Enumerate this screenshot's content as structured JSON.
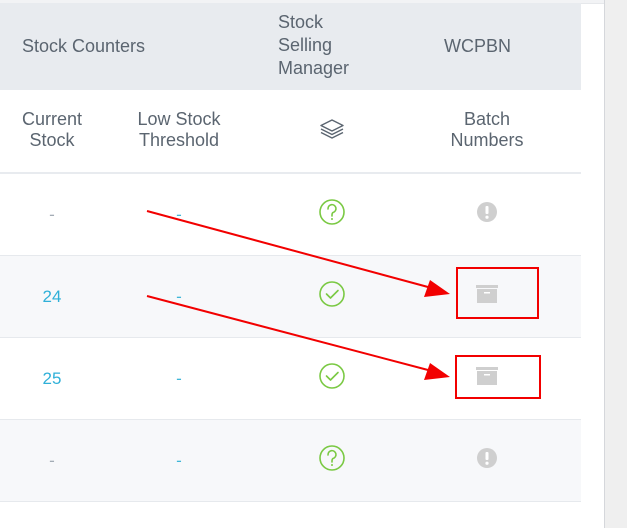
{
  "header": {
    "groups": {
      "stock_counters": "Stock Counters",
      "stock_selling_manager_line1": "Stock",
      "stock_selling_manager_line2": "Selling",
      "stock_selling_manager_line3": "Manager",
      "wcpbn": "WCPBN"
    },
    "columns": {
      "current_stock_line1": "Current",
      "current_stock_line2": "Stock",
      "low_stock_line1": "Low Stock",
      "low_stock_line2": "Threshold",
      "ssm_icon": "layers-icon",
      "batch_numbers_line1": "Batch",
      "batch_numbers_line2": "Numbers"
    }
  },
  "rows": [
    {
      "current_stock": "-",
      "low_stock_threshold": "-",
      "ssm_status": "question-circle-icon",
      "batch_numbers": "exclamation-circle-icon"
    },
    {
      "current_stock": "24",
      "low_stock_threshold": "-",
      "ssm_status": "check-circle-icon",
      "batch_numbers": "archive-box-icon"
    },
    {
      "current_stock": "25",
      "low_stock_threshold": "-",
      "ssm_status": "check-circle-icon",
      "batch_numbers": "archive-box-icon"
    },
    {
      "current_stock": "-",
      "low_stock_threshold": "-",
      "ssm_status": "question-circle-icon",
      "batch_numbers": "exclamation-circle-icon"
    }
  ],
  "annotations": {
    "color": "#f20000",
    "highlighted": [
      "row-2-batch-numbers",
      "row-3-batch-numbers"
    ]
  },
  "colors": {
    "status_green": "#7ac943",
    "icon_gray": "#cfcfcf",
    "link_blue": "#2fb0d8",
    "header_bg": "#e8ebef"
  }
}
